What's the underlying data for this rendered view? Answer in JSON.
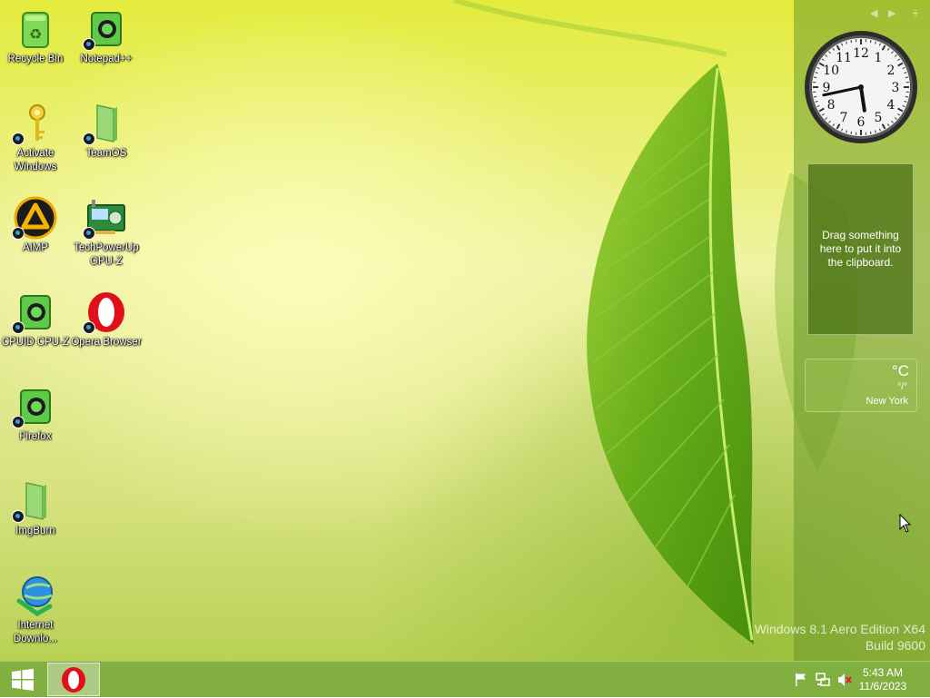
{
  "desktop": {
    "icons": [
      {
        "label": "Recycle Bin",
        "icon": "recycle-bin-icon"
      },
      {
        "label": "Notepad++",
        "icon": "app-icon"
      },
      {
        "label": "Activate Windows",
        "icon": "key-icon"
      },
      {
        "label": "TeamOS",
        "icon": "folder-icon"
      },
      {
        "label": "AIMP",
        "icon": "aimp-icon"
      },
      {
        "label": "TechPowerUp GPU-Z",
        "icon": "gpu-card-icon"
      },
      {
        "label": "CPUID CPU-Z",
        "icon": "app-icon"
      },
      {
        "label": "Opera Browser",
        "icon": "opera-icon"
      },
      {
        "label": "Firefox",
        "icon": "app-icon"
      },
      {
        "label": "ImgBurn",
        "icon": "folder-icon"
      },
      {
        "label": "Internet Downlo...",
        "icon": "globe-download-icon"
      }
    ]
  },
  "sidebar": {
    "controls": {
      "prev": "◀",
      "next": "▶",
      "add": "+"
    },
    "clock": {
      "numbers": [
        "12",
        "1",
        "2",
        "3",
        "4",
        "5",
        "6",
        "7",
        "8",
        "9",
        "10",
        "11"
      ],
      "hour": 5,
      "minute": 43
    },
    "clipboard": {
      "text": "Drag something here to put it into the clipboard."
    },
    "weather": {
      "temp": "°C",
      "range": "°/°",
      "city": "New York"
    }
  },
  "watermark": {
    "line1": "Windows 8.1 Aero Edition X64",
    "line2": "Build 9600"
  },
  "taskbar": {
    "time": "5:43 AM",
    "date": "11/6/2023",
    "tray_icons": [
      "flag-icon",
      "network-icon",
      "speaker-muted-icon"
    ]
  },
  "colors": {
    "taskbar": "#78aa32",
    "accent_green": "#6a9a1c",
    "opera_red": "#e0101a"
  }
}
